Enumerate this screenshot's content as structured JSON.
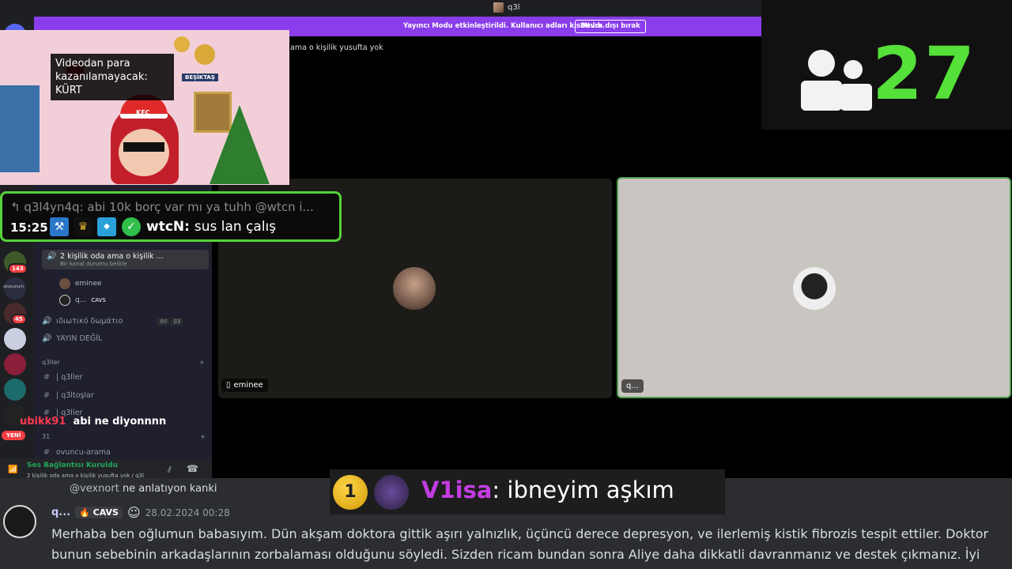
{
  "titlebar": {
    "title": "q3l"
  },
  "banner": {
    "message": "Yayıncı Modu etkinleştirildi. Kullanıcı adları kısaltıldı.",
    "button_label": "Devre dışı bırak"
  },
  "header": {
    "channel_fragment": "ama o kişilik yusufta yok"
  },
  "rail": {
    "badges": [
      "143",
      "45"
    ],
    "server_label": "okucunum",
    "new_label": "YENİ"
  },
  "sidebar": {
    "active_channel": {
      "name": "2 kişilik oda ama o kişilik ...",
      "status": "Bir kanal durumu belirle"
    },
    "voice_users": [
      {
        "name": "eminee"
      },
      {
        "name": "q...",
        "tag": "CAVS"
      }
    ],
    "channels": [
      {
        "name": "ιδιωτικό δωμάτιο",
        "count_a": "00",
        "count_b": "03"
      },
      {
        "name": "YAYIN DEĞİL"
      }
    ],
    "category": {
      "name": "q3ller"
    },
    "text_channels": [
      "| q3ller",
      "| q3ltoşlar",
      "| q3ller"
    ],
    "category2": {
      "name": "31"
    },
    "text_channel_last": "ovuncu-arama"
  },
  "voicebar": {
    "status": "Ses Bağlantısı Kuruldu",
    "location": "2 kişilik oda ama o kişilik yusufta yok / q3l"
  },
  "tiles": [
    {
      "name": "eminee"
    },
    {
      "name": "q..."
    }
  ],
  "webcam": {
    "caption": "Videodan para kazanılamayacak: KÜRT",
    "sign": "BEŞİKTAŞ",
    "cap_label": "KFC"
  },
  "counter": {
    "value": "27"
  },
  "chat_popup": {
    "reply": "q3l4yn4q: abi 10k borç var mı ya tuhh @wtcn i...",
    "time": "15:25",
    "author": "wtcN",
    "message": "sus lan çalış"
  },
  "red_message": {
    "author": "ubikk91",
    "text": "abi ne diyonnnn"
  },
  "donation": {
    "rank": "1",
    "author": "V1isa",
    "text": "ibneyim aşkım"
  },
  "bottom_chat": {
    "reply_mention": "@vexnort",
    "reply_text": "ne anlatıyon kanki",
    "author": "q...",
    "tag": "CAVS",
    "date": "28.02.2024 00:28",
    "body": "Merhaba ben oğlumun babasıyım. Dün akşam doktora gittik aşırı yalnızlık, üçüncü derece depresyon, ve ilerlemiş kistik fibrozis tespit ettiler. Doktor bunun sebebinin arkadaşlarının zorbalaması olduğunu söyledi. Sizden ricam bundan sonra Aliye daha dikkatli davranmanız ve destek çıkmanız. İyi"
  }
}
